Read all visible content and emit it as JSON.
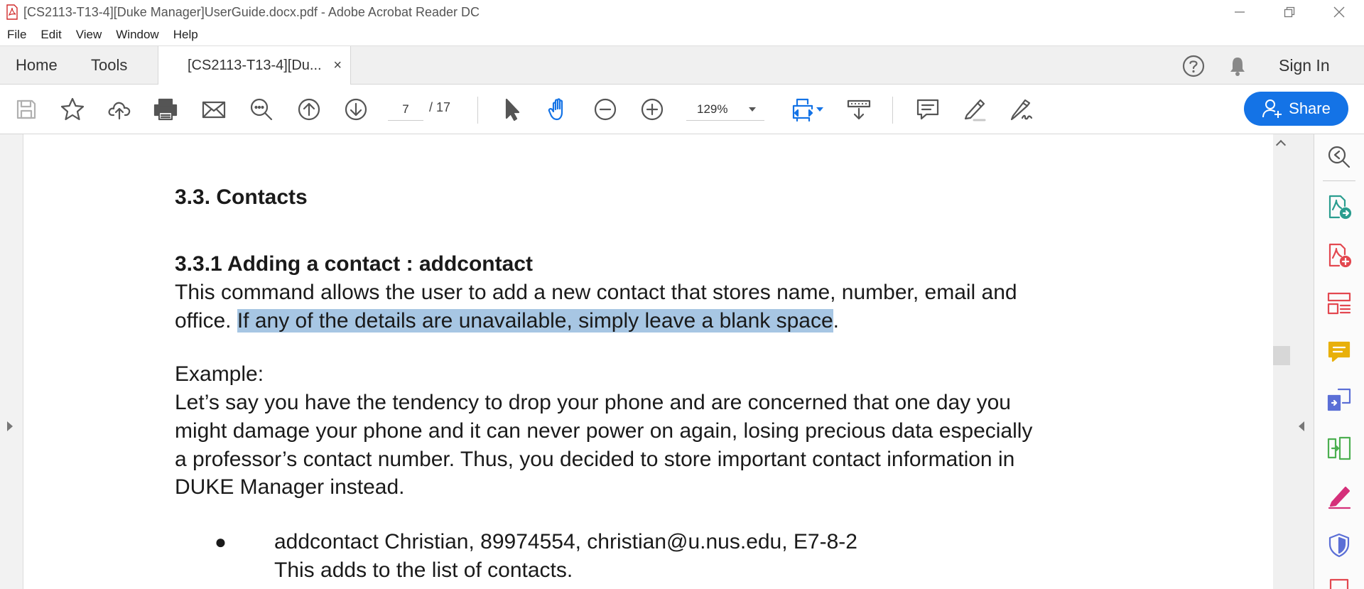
{
  "window": {
    "title": "[CS2113-T13-4][Duke Manager]UserGuide.docx.pdf - Adobe Acrobat Reader DC"
  },
  "menu": [
    "File",
    "Edit",
    "View",
    "Window",
    "Help"
  ],
  "tabs": {
    "home": "Home",
    "tools": "Tools",
    "document": "[CS2113-T13-4][Du...",
    "close": "×",
    "sign_in": "Sign In"
  },
  "toolbar": {
    "page_current": "7",
    "page_total": "/ 17",
    "zoom": "129%",
    "share_label": "Share"
  },
  "document": {
    "section_heading": "3.3. Contacts",
    "subsection_heading": "3.3.1 Adding a contact : addcontact",
    "intro_line1": "This command allows the user to add a new contact that stores name, number, email and",
    "intro_line2_prefix": "office. ",
    "intro_line2_highlight": "If any of the details are unavailable, simply leave a blank space",
    "intro_line2_suffix": ".",
    "example_label": "Example:",
    "example_lines": [
      "Let’s say you have the tendency to drop your phone and are concerned that one day you",
      "might damage your phone and it can never power on again, losing precious data especially",
      "a professor’s contact number. Thus, you decided to store important contact information in",
      "DUKE Manager instead."
    ],
    "bullet_marker": "●",
    "bullet_command": "addcontact Christian, 89974554, christian@u.nus.edu, E7-8-2",
    "bullet_desc": "This adds to the list of contacts."
  },
  "colors": {
    "accent": "#1473e6",
    "highlight": "#a7c6e3"
  }
}
